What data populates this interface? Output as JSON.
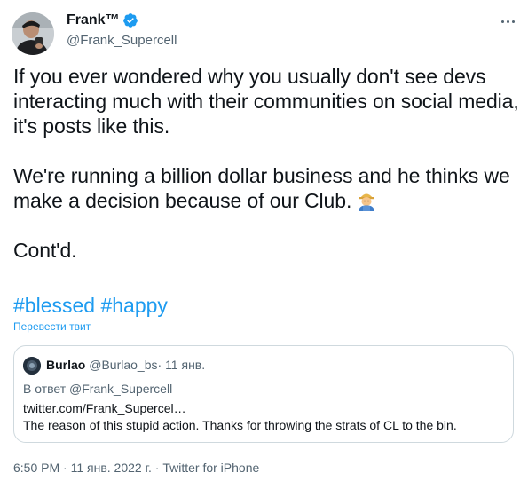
{
  "author": {
    "display_name": "Frank™",
    "handle": "@Frank_Supercell",
    "verified_icon": "verified-badge-icon"
  },
  "more_icon": "more-horizontal-icon",
  "body": {
    "paragraph_1": "If you ever wondered why you usually don't see devs interacting much with their communities on social media, it's posts like this.",
    "paragraph_2": "We're running a billion dollar business and he thinks we make a decision because of our Club.",
    "emoji": "farmer-emoji",
    "paragraph_3": "Cont'd."
  },
  "hashtags": [
    "#blessed",
    "#happy"
  ],
  "translate_label": "Перевести твит",
  "quote": {
    "display_name": "Burlao",
    "handle": "@Burlao_bs",
    "separator": "·",
    "date": "11 янв.",
    "reply_prefix": "В ответ",
    "reply_to": "@Frank_Supercell",
    "link": "twitter.com/Frank_Supercel…",
    "text": "The reason of this stupid action. Thanks for throwing the strats of CL to the bin."
  },
  "meta": {
    "time": "6:50 PM",
    "separator": "·",
    "date": "11 янв. 2022 г.",
    "source": "Twitter for iPhone"
  },
  "colors": {
    "link_blue": "#1d9bf0",
    "secondary_text": "#536471",
    "primary_text": "#0f1419",
    "border": "#cfd9de"
  }
}
